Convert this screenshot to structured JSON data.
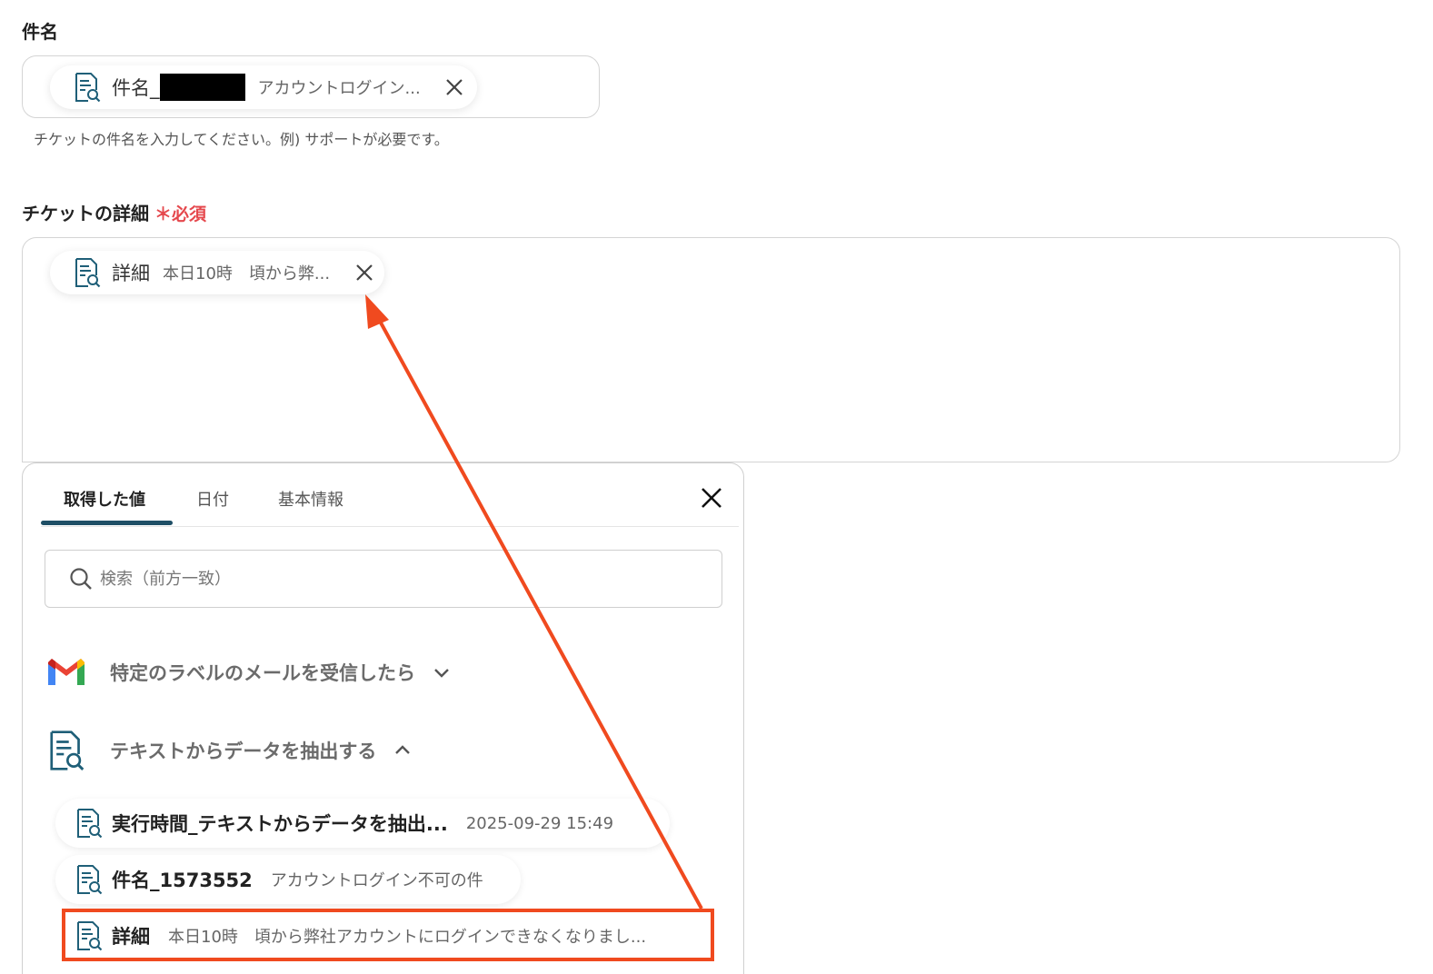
{
  "subject": {
    "label": "件名",
    "chip_name": "件名_",
    "chip_value": "アカウントログイン...",
    "help": "チケットの件名を入力してください。例) サポートが必要です。"
  },
  "details": {
    "label": "チケットの詳細",
    "required_mark": "＊",
    "required_text": "必須",
    "chip_name": "詳細",
    "chip_value": "本日10時　頃から弊..."
  },
  "panel": {
    "tabs": [
      {
        "label": "取得した値",
        "active": true
      },
      {
        "label": "日付",
        "active": false
      },
      {
        "label": "基本情報",
        "active": false
      }
    ],
    "search_placeholder": "検索（前方一致）",
    "sections": [
      {
        "title": "特定のラベルのメールを受信したら",
        "icon": "gmail-icon",
        "expanded": false
      },
      {
        "title": "テキストからデータを抽出する",
        "icon": "document-search-icon",
        "expanded": true
      }
    ],
    "items": [
      {
        "name": "実行時間_テキストからデータを抽出...",
        "value": "2025-09-29 15:49"
      },
      {
        "name": "件名_1573552",
        "value": "アカウントログイン不可の件"
      },
      {
        "name": "詳細",
        "value": "本日10時　頃から弊社アカウントにログインできなくなりまし..."
      }
    ]
  },
  "colors": {
    "accent": "#1f4f66",
    "icon": "#1f5f78",
    "required": "#e5484d",
    "annotation": "#f04a1f"
  }
}
